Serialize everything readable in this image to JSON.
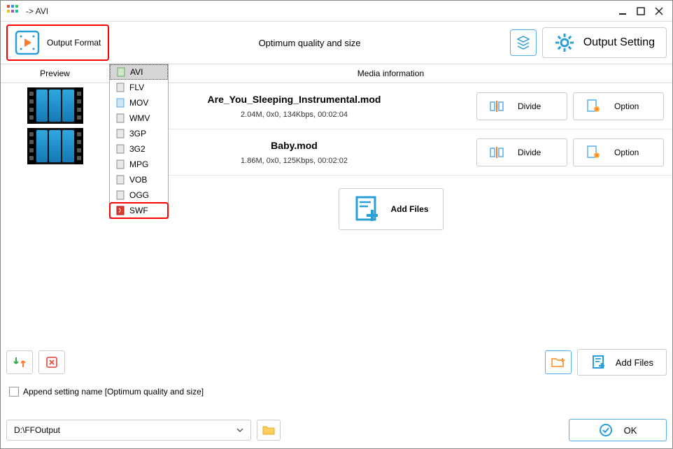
{
  "titlebar": {
    "title": "-> AVI"
  },
  "toolbar": {
    "output_format_label": "Output Format",
    "center_text": "Optimum quality and size",
    "output_setting_label": "Output Setting"
  },
  "dropdown": {
    "items": [
      {
        "label": "AVI",
        "selected": true
      },
      {
        "label": "FLV"
      },
      {
        "label": "MOV"
      },
      {
        "label": "WMV"
      },
      {
        "label": "3GP"
      },
      {
        "label": "3G2"
      },
      {
        "label": "MPG"
      },
      {
        "label": "VOB"
      },
      {
        "label": "OGG"
      },
      {
        "label": "SWF",
        "highlight": true
      }
    ]
  },
  "preview": {
    "header": "Preview"
  },
  "media": {
    "header": "Media information"
  },
  "files": [
    {
      "name": "Are_You_Sleeping_Instrumental.mod",
      "meta": "2.04M, 0x0, 134Kbps, 00:02:04"
    },
    {
      "name": "Baby.mod",
      "meta": "1.86M, 0x0, 125Kbps, 00:02:02"
    }
  ],
  "buttons": {
    "divide": "Divide",
    "option": "Option",
    "add_files": "Add Files",
    "ok": "OK"
  },
  "append": {
    "label": "Append setting name [Optimum quality and size]"
  },
  "output": {
    "path": "D:\\FFOutput"
  }
}
